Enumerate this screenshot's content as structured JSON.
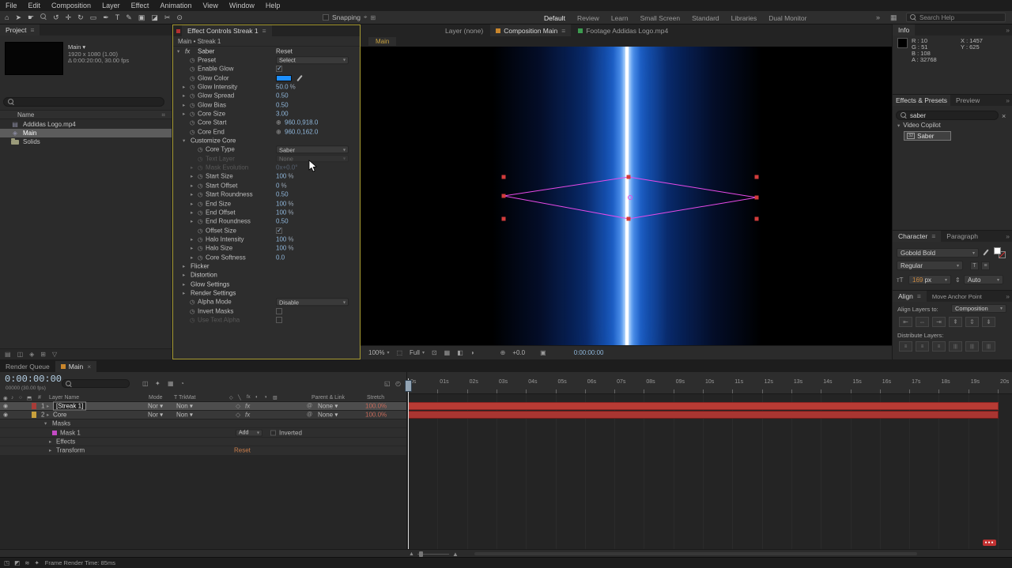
{
  "colors": {
    "value_blue": "#8fb6da",
    "glow_swatch": "#1d8fff",
    "mask_magenta": "#e84ae8",
    "handle_red": "#d23c3c",
    "layer_bar_red": "#a93531",
    "panel_focus_border": "#a79b33",
    "stretch_red": "#c4695a",
    "reset_orange": "#c87c4a",
    "comp_tab_orange": "#c9a23f"
  },
  "menu_bar": {
    "items": [
      "File",
      "Edit",
      "Composition",
      "Layer",
      "Effect",
      "Animation",
      "View",
      "Window",
      "Help"
    ]
  },
  "toolbar": {
    "tools": [
      {
        "name": "home-icon",
        "glyph": "⌂"
      },
      {
        "name": "selection-tool-icon",
        "glyph": "➤"
      },
      {
        "name": "hand-tool-icon",
        "glyph": "☛"
      },
      {
        "name": "zoom-tool-icon",
        "glyph": "mag"
      },
      {
        "name": "orbit-camera-tool-icon",
        "glyph": "↺"
      },
      {
        "name": "pan-camera-tool-icon",
        "glyph": "✛"
      },
      {
        "name": "rotation-tool-icon",
        "glyph": "↻"
      },
      {
        "name": "rectangle-tool-icon",
        "glyph": "▭"
      },
      {
        "name": "pen-tool-icon",
        "glyph": "✒"
      },
      {
        "name": "type-tool-icon",
        "glyph": "T"
      },
      {
        "name": "brush-tool-icon",
        "glyph": "✎"
      },
      {
        "name": "clone-stamp-tool-icon",
        "glyph": "▣"
      },
      {
        "name": "eraser-tool-icon",
        "glyph": "◪"
      },
      {
        "name": "roto-brush-tool-icon",
        "glyph": "✂"
      },
      {
        "name": "puppet-pin-tool-icon",
        "glyph": "⊙"
      }
    ],
    "snapping_label": "Snapping",
    "snapping_checked": false,
    "workspaces": [
      {
        "label": "Default",
        "active": true
      },
      {
        "label": "Review",
        "active": false
      },
      {
        "label": "Learn",
        "active": false
      },
      {
        "label": "Small Screen",
        "active": false
      },
      {
        "label": "Standard",
        "active": false
      },
      {
        "label": "Libraries",
        "active": false
      },
      {
        "label": "Dual Monitor",
        "active": false
      }
    ],
    "overflow_glyph": "»",
    "search_placeholder": "Search Help"
  },
  "project_panel": {
    "tab": "Project",
    "preview": {
      "name": "Main",
      "caret": "▾",
      "meta1": "1920 x 1080 (1.00)",
      "meta2": "Δ 0:00:20:00, 30.00 fps"
    },
    "name_header": "Name",
    "items": [
      {
        "label": "Addidas Logo.mp4",
        "type": "footage",
        "selected": false
      },
      {
        "label": "Main",
        "type": "composition",
        "selected": true
      },
      {
        "label": "Solids",
        "type": "folder",
        "selected": false
      }
    ],
    "bottom_icons": [
      {
        "name": "interpret-footage-icon",
        "glyph": "▤"
      },
      {
        "name": "new-folder-icon",
        "glyph": "◫"
      },
      {
        "name": "new-composition-icon",
        "glyph": "◈"
      },
      {
        "name": "project-settings-icon",
        "glyph": "⊞"
      },
      {
        "name": "delete-icon",
        "glyph": "▽"
      }
    ]
  },
  "effect_controls": {
    "tab": "Effect Controls Streak 1",
    "subtitle": "Main • Streak 1",
    "effect": {
      "name": "Saber",
      "reset": "Reset"
    },
    "rows": [
      {
        "label": "Preset",
        "type": "dropdown",
        "value": "Select"
      },
      {
        "label": "Enable Glow",
        "type": "checkbox",
        "checked": true
      },
      {
        "label": "Glow Color",
        "type": "color"
      },
      {
        "label": "Glow Intensity",
        "type": "value",
        "value": "50.0",
        "suffix": "%"
      },
      {
        "label": "Glow Spread",
        "type": "value",
        "value": "0.50"
      },
      {
        "label": "Glow Bias",
        "type": "value",
        "value": "0.50"
      },
      {
        "label": "Core Size",
        "type": "value",
        "value": "3.00"
      },
      {
        "label": "Core Start",
        "type": "point",
        "value": "960.0,918.0"
      },
      {
        "label": "Core End",
        "type": "point",
        "value": "960.0,162.0"
      },
      {
        "label": "Customize Core",
        "type": "group",
        "expanded": true
      },
      {
        "label": "Core Type",
        "type": "dropdown",
        "value": "Saber",
        "indent": 1
      },
      {
        "label": "Text Layer",
        "type": "dropdown",
        "value": "None",
        "indent": 1,
        "disabled": true
      },
      {
        "label": "Mask Evolution",
        "type": "value",
        "value": "0x+0.0°",
        "indent": 1,
        "disabled": true
      },
      {
        "label": "Start Size",
        "type": "value",
        "value": "100",
        "suffix": "%",
        "indent": 1
      },
      {
        "label": "Start Offset",
        "type": "value",
        "value": "0",
        "suffix": "%",
        "indent": 1
      },
      {
        "label": "Start Roundness",
        "type": "value",
        "value": "0.50",
        "indent": 1
      },
      {
        "label": "End Size",
        "type": "value",
        "value": "100",
        "suffix": "%",
        "indent": 1
      },
      {
        "label": "End Offset",
        "type": "value",
        "value": "100",
        "suffix": "%",
        "indent": 1
      },
      {
        "label": "End Roundness",
        "type": "value",
        "value": "0.50",
        "indent": 1
      },
      {
        "label": "Offset Size",
        "type": "checkbox",
        "checked": true,
        "indent": 1
      },
      {
        "label": "Halo Intensity",
        "type": "value",
        "value": "100",
        "suffix": "%",
        "indent": 1
      },
      {
        "label": "Halo Size",
        "type": "value",
        "value": "100",
        "suffix": "%",
        "indent": 1
      },
      {
        "label": "Core Softness",
        "type": "value",
        "value": "0.0",
        "indent": 1
      },
      {
        "label": "Flicker",
        "type": "group",
        "expanded": false
      },
      {
        "label": "Distortion",
        "type": "group",
        "expanded": false
      },
      {
        "label": "Glow Settings",
        "type": "group",
        "expanded": false
      },
      {
        "label": "Render Settings",
        "type": "group",
        "expanded": false
      },
      {
        "label": "Alpha Mode",
        "type": "dropdown",
        "value": "Disable"
      },
      {
        "label": "Invert Masks",
        "type": "checkbox",
        "checked": false
      },
      {
        "label": "Use Text Alpha",
        "type": "checkbox",
        "checked": false,
        "disabled": true
      }
    ]
  },
  "viewer": {
    "tabs": [
      {
        "label": "Layer (none)",
        "active": false,
        "swatch": ""
      },
      {
        "label": "Composition Main",
        "active": true,
        "swatch": "#c9862c"
      },
      {
        "label": "Footage Addidas Logo.mp4",
        "active": false,
        "swatch": "#3c9b4f"
      }
    ],
    "comp_tab": "Main",
    "bottom_bar": {
      "zoom": "100%",
      "resolution": "Full",
      "exposure": "+0.0",
      "time": "0:00:00:00"
    }
  },
  "info_panel": {
    "tab": "Info",
    "r": "R : 10",
    "g": "G : 51",
    "b": "B : 108",
    "a": "A : 32768",
    "x": "X : 1457",
    "y": "Y : 625"
  },
  "effects_presets": {
    "tab": "Effects & Presets",
    "neighbor_tab": "Preview",
    "search_value": "saber",
    "clear_glyph": "×",
    "group": "Video Copilot",
    "item": {
      "badge": "32",
      "label": "Saber"
    }
  },
  "character_panel": {
    "tab": "Character",
    "neighbor_tab": "Paragraph",
    "font_family": "Gobold Bold",
    "font_style": "Regular",
    "font_size": "169",
    "font_size_unit": "px",
    "leading": "Auto"
  },
  "align_panel": {
    "tab": "Align",
    "neighbor_tab": "Move Anchor Point",
    "align_to_label": "Align Layers to:",
    "align_to_value": "Composition",
    "distribute_label": "Distribute Layers:",
    "align_buttons": [
      {
        "name": "align-left-button",
        "glyph": "⇤"
      },
      {
        "name": "align-h-center-button",
        "glyph": "⇔"
      },
      {
        "name": "align-right-button",
        "glyph": "⇥"
      },
      {
        "name": "align-top-button",
        "glyph": "⇞"
      },
      {
        "name": "align-v-center-button",
        "glyph": "⇕"
      },
      {
        "name": "align-bottom-button",
        "glyph": "⇟"
      }
    ],
    "distribute_buttons": [
      {
        "name": "distribute-top-button",
        "glyph": "≡"
      },
      {
        "name": "distribute-v-center-button",
        "glyph": "≡"
      },
      {
        "name": "distribute-bottom-button",
        "glyph": "≡"
      },
      {
        "name": "distribute-left-button",
        "glyph": "|||"
      },
      {
        "name": "distribute-h-center-button",
        "glyph": "|||"
      },
      {
        "name": "distribute-right-button",
        "glyph": "|||"
      }
    ]
  },
  "timeline": {
    "tabs": {
      "render_queue": "Render Queue",
      "main": "Main",
      "close_glyph": "×"
    },
    "current_time": "0:00:00:00",
    "frame_info": "00000 (30.00 fps)",
    "columns": {
      "hash": "#",
      "layer_name": "Layer Name",
      "mode": "Mode",
      "trkmat": "T TrkMat",
      "parent": "Parent & Link",
      "stretch": "Stretch"
    },
    "header_icons": [
      {
        "name": "video-column-icon",
        "glyph": "◉"
      },
      {
        "name": "audio-column-icon",
        "glyph": "♪"
      },
      {
        "name": "solo-column-icon",
        "glyph": "○"
      },
      {
        "name": "lock-column-icon",
        "glyph": "⬒"
      }
    ],
    "switch_header_icons": [
      {
        "name": "shy-column-icon",
        "glyph": "◇"
      },
      {
        "name": "collapse-column-icon",
        "glyph": "╲"
      },
      {
        "name": "fx-column-icon",
        "glyph": "fx"
      },
      {
        "name": "motion-blur-column-icon",
        "glyph": "◐"
      },
      {
        "name": "adjustment-column-icon",
        "glyph": "◑"
      },
      {
        "name": "threed-column-icon",
        "glyph": "▧"
      }
    ],
    "control_icons": [
      {
        "name": "comp-mini-flowchart-icon",
        "glyph": "◫"
      },
      {
        "name": "draft-3d-icon",
        "glyph": "✦"
      },
      {
        "name": "frame-blending-icon",
        "glyph": "▦"
      },
      {
        "name": "motion-blur-master-icon",
        "glyph": "◔"
      }
    ],
    "ruler_ticks": [
      "0s",
      "01s",
      "02s",
      "03s",
      "04s",
      "05s",
      "06s",
      "07s",
      "08s",
      "09s",
      "10s",
      "11s",
      "12s",
      "13s",
      "14s",
      "15s",
      "16s",
      "17s",
      "18s",
      "19s",
      "20s"
    ],
    "layers": [
      {
        "num": "1",
        "name": "[Streak 1]",
        "mode": "Nor",
        "trkmat": "Non",
        "parent": "None",
        "stretch": "100.0%",
        "selected": true,
        "label_color": "#a83c38"
      },
      {
        "num": "2",
        "name": "Core",
        "mode": "Nor",
        "trkmat": "Non",
        "parent": "None",
        "stretch": "100.0%",
        "selected": false,
        "label_color": "#c8a03c"
      }
    ],
    "property_rows": [
      {
        "label": "Masks",
        "twirl": "▾"
      },
      {
        "label": "Mask 1",
        "chip": true,
        "mode_dropdown": "Add",
        "inverted_label": "Inverted"
      },
      {
        "label": "Effects",
        "twirl": "▸"
      },
      {
        "label": "Transform",
        "twirl": "▸",
        "reset": "Reset"
      }
    ]
  },
  "status_bar": {
    "icons": [
      {
        "name": "project-indicator-icon",
        "glyph": "◳"
      },
      {
        "name": "adaptive-resolution-icon",
        "glyph": "◩"
      },
      {
        "name": "draft-preview-icon",
        "glyph": "≋"
      },
      {
        "name": "notifications-icon",
        "glyph": "✦"
      }
    ],
    "frame_render_time": "Frame Render Time: 85ms"
  }
}
